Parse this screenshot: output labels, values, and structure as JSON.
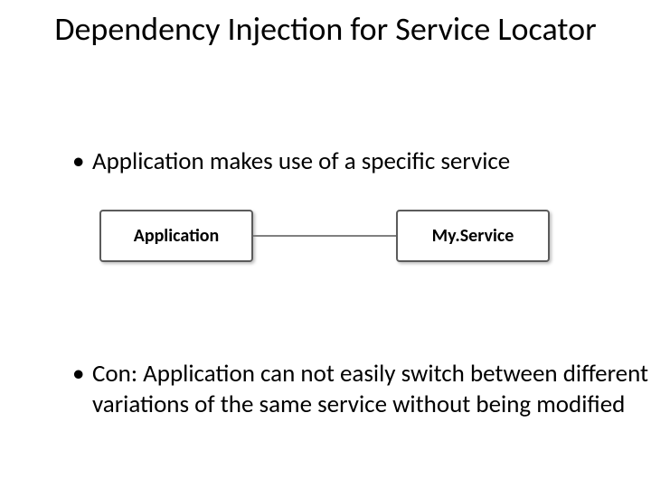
{
  "title": "Dependency Injection for Service Locator",
  "bullets": {
    "b1": "Application makes use of a specific service",
    "b2": "Con: Application can not easily switch between different variations of the same service without being modified"
  },
  "diagram": {
    "left_label": "Application",
    "right_label": "My.Service"
  }
}
